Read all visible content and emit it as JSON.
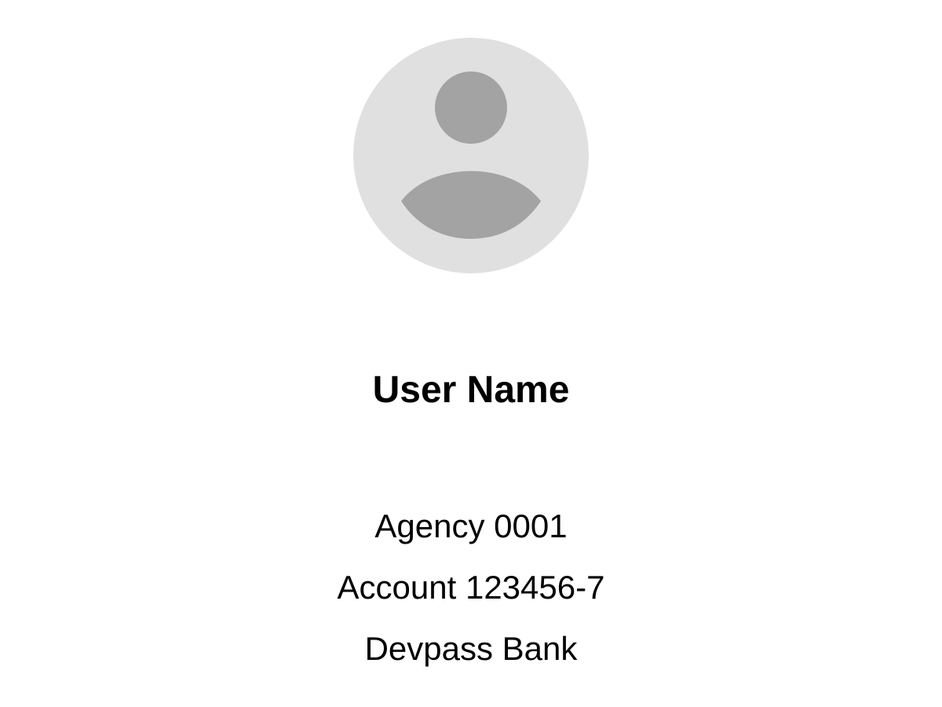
{
  "profile": {
    "user_name": "User Name",
    "agency": "Agency 0001",
    "account": "Account 123456-7",
    "bank": "Devpass Bank"
  },
  "avatar": {
    "icon": "person-placeholder-icon",
    "background_color": "#E0E0E0",
    "figure_color": "#A3A3A3"
  }
}
